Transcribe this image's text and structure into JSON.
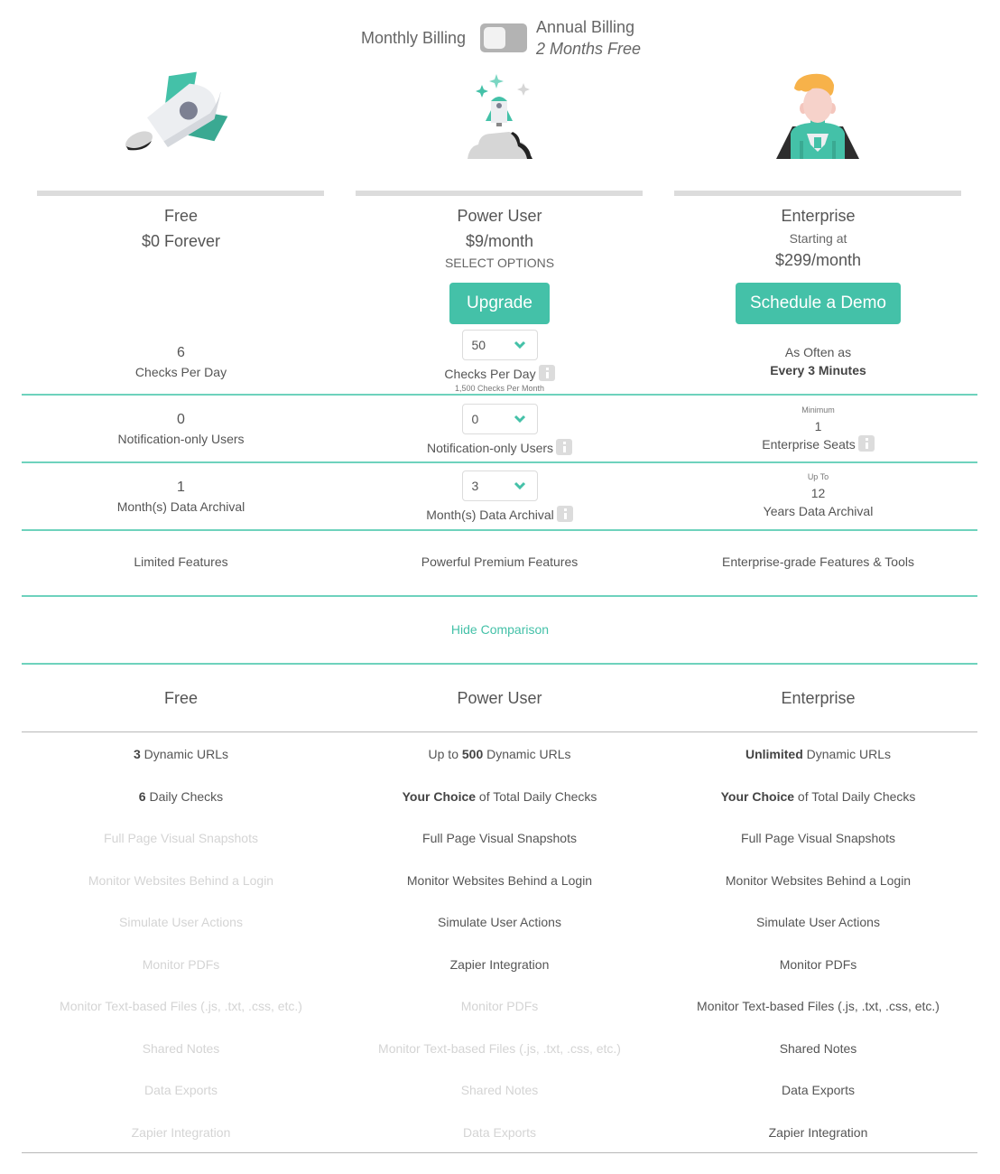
{
  "billing": {
    "monthly_label": "Monthly Billing",
    "annual_label": "Annual Billing",
    "annual_note": "2 Months Free",
    "annual_selected": false
  },
  "colors": {
    "accent": "#44c1a8",
    "rule": "#6ed2bd",
    "bar": "#dcdcdc"
  },
  "plans": [
    {
      "illustration": "rocket-icon",
      "name": "Free",
      "price": "$0 Forever",
      "checks": {
        "value": "6",
        "label": "Checks Per Day"
      },
      "users": {
        "value": "0",
        "label": "Notification-only Users"
      },
      "archival": {
        "value": "1",
        "label": "Month(s) Data Archival"
      },
      "features_summary": "Limited Features"
    },
    {
      "illustration": "rocket-launch-icon",
      "name": "Power User",
      "price": "$9/month",
      "select_options": "SELECT OPTIONS",
      "cta": "Upgrade",
      "checks": {
        "value": "50",
        "label": "Checks Per Day",
        "note": "1,500 Checks Per Month"
      },
      "users": {
        "value": "0",
        "label": "Notification-only Users"
      },
      "archival": {
        "value": "3",
        "label": "Month(s) Data Archival"
      },
      "features_summary": "Powerful Premium Features"
    },
    {
      "illustration": "superhero-icon",
      "name": "Enterprise",
      "starting_at": "Starting at",
      "price": "$299/month",
      "cta": "Schedule a Demo",
      "checks": {
        "prefix": "As Often as",
        "value": "Every 3 Minutes"
      },
      "seats": {
        "prefix": "Minimum",
        "value": "1",
        "label": "Enterprise Seats"
      },
      "archival": {
        "prefix": "Up To",
        "value": "12",
        "label": "Years Data Archival"
      },
      "features_summary": "Enterprise-grade Features & Tools"
    }
  ],
  "hide_comparison": "Hide Comparison",
  "comparison": {
    "headers": [
      "Free",
      "Power User",
      "Enterprise"
    ],
    "columns": [
      [
        {
          "bold": "3",
          "text": " Dynamic URLs",
          "enabled": true
        },
        {
          "bold": "6",
          "text": " Daily Checks",
          "enabled": true
        },
        {
          "text": "Full Page Visual Snapshots",
          "enabled": false
        },
        {
          "text": "Monitor Websites Behind a Login",
          "enabled": false
        },
        {
          "text": "Simulate User Actions",
          "enabled": false
        },
        {
          "text": "Monitor PDFs",
          "enabled": false
        },
        {
          "text": "Monitor Text-based Files (.js, .txt, .css, etc.)",
          "enabled": false
        },
        {
          "text": "Shared Notes",
          "enabled": false
        },
        {
          "text": "Data Exports",
          "enabled": false
        },
        {
          "text": "Zapier Integration",
          "enabled": false
        }
      ],
      [
        {
          "pre": "Up to ",
          "bold": "500",
          "text": " Dynamic URLs",
          "enabled": true
        },
        {
          "bold": "Your Choice",
          "text": " of Total Daily Checks",
          "enabled": true
        },
        {
          "text": "Full Page Visual Snapshots",
          "enabled": true
        },
        {
          "text": "Monitor Websites Behind a Login",
          "enabled": true
        },
        {
          "text": "Simulate User Actions",
          "enabled": true
        },
        {
          "text": "Zapier Integration",
          "enabled": true
        },
        {
          "text": "Monitor PDFs",
          "enabled": false
        },
        {
          "text": "Monitor Text-based Files (.js, .txt, .css, etc.)",
          "enabled": false
        },
        {
          "text": "Shared Notes",
          "enabled": false
        },
        {
          "text": "Data Exports",
          "enabled": false
        }
      ],
      [
        {
          "bold": "Unlimited",
          "text": " Dynamic URLs",
          "enabled": true
        },
        {
          "bold": "Your Choice",
          "text": " of Total Daily Checks",
          "enabled": true
        },
        {
          "text": "Full Page Visual Snapshots",
          "enabled": true
        },
        {
          "text": "Monitor Websites Behind a Login",
          "enabled": true
        },
        {
          "text": "Simulate User Actions",
          "enabled": true
        },
        {
          "text": "Monitor PDFs",
          "enabled": true
        },
        {
          "text": "Monitor Text-based Files (.js, .txt, .css, etc.)",
          "enabled": true
        },
        {
          "text": "Shared Notes",
          "enabled": true
        },
        {
          "text": "Data Exports",
          "enabled": true
        },
        {
          "text": "Zapier Integration",
          "enabled": true
        }
      ]
    ]
  }
}
